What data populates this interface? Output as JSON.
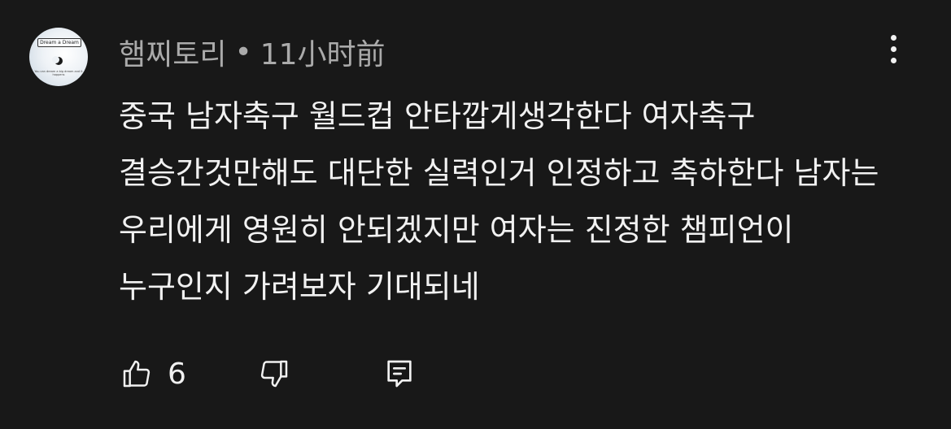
{
  "comment": {
    "author": "햄찌토리",
    "separator": "•",
    "time": "11小时前",
    "text": "중국 남자축구 월드컵 안타깝게생각한다 여자축구 결승간것만해도 대단한 실력인거 인정하고 축하한다 남자는 우리에게 영원히 안되겠지만 여자는 진정한 챔피언이 누구인지 가려보자 기대되네",
    "like_count": "6"
  },
  "avatar": {
    "badge_text": "Dream a Dream",
    "sub_text": "You can dream a big dream and it happens"
  },
  "icons": {
    "like": "thumbs-up-icon",
    "dislike": "thumbs-down-icon",
    "reply": "reply-comment-icon",
    "menu": "more-vertical-icon"
  },
  "colors": {
    "background": "#181818",
    "primary_text": "#f1f1f1",
    "secondary_text": "#aaaaaa"
  }
}
